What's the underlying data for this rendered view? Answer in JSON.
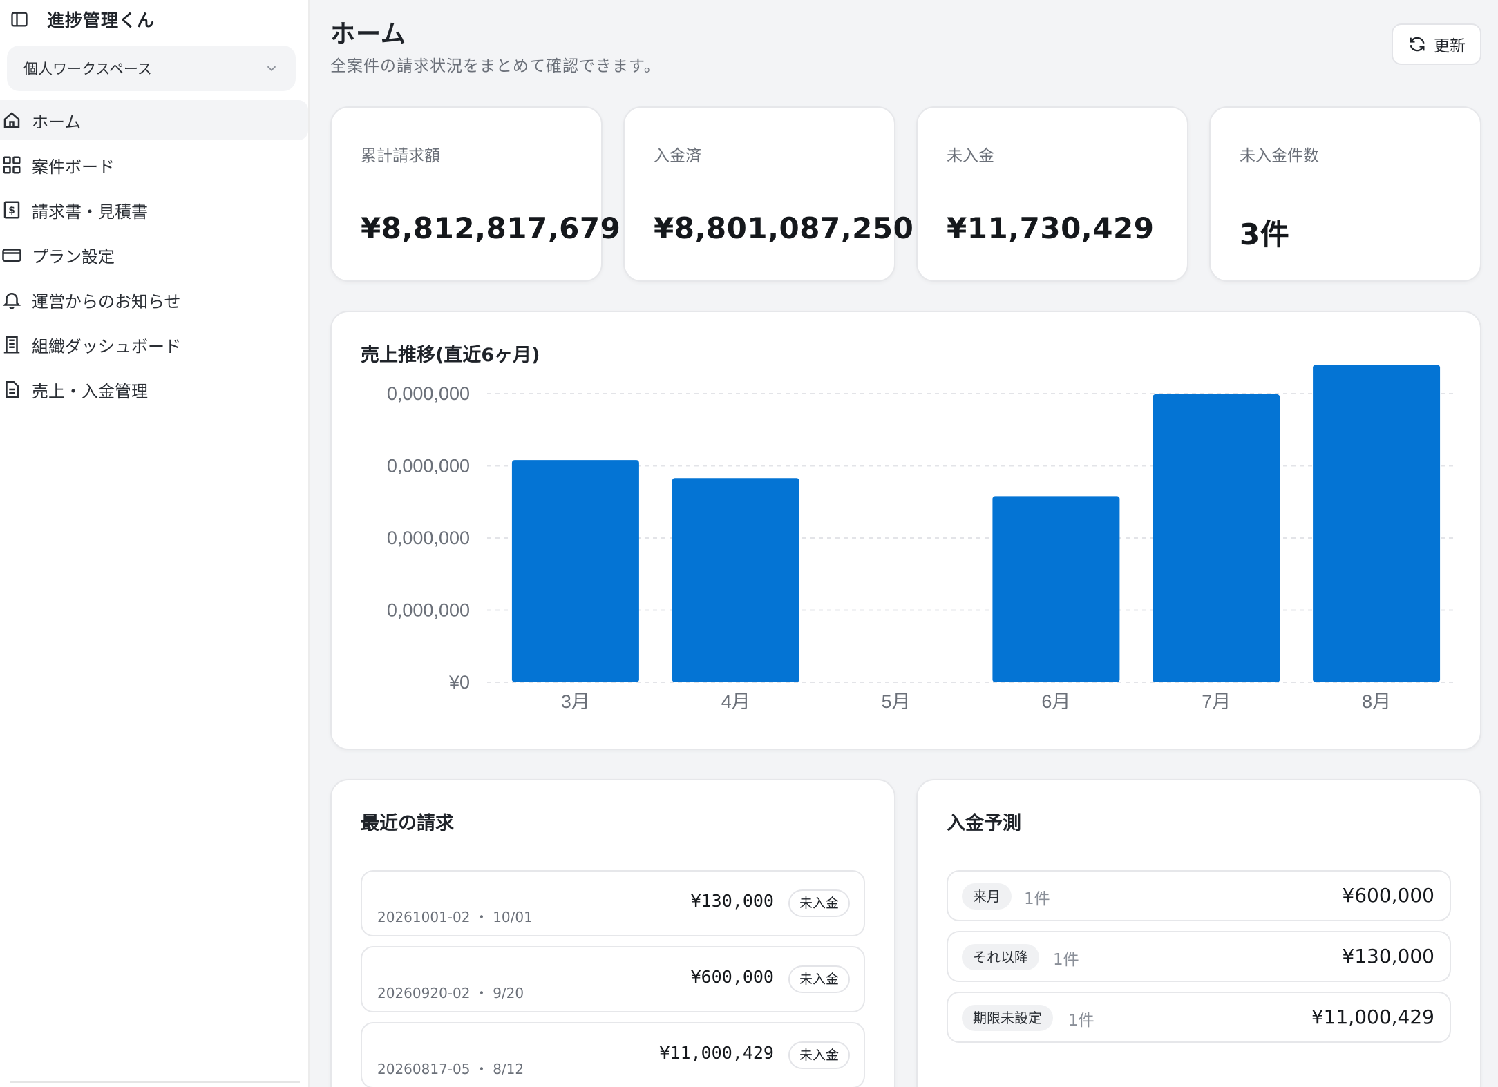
{
  "app": {
    "title": "進捗管理くん"
  },
  "workspace": {
    "selected": "個人ワークスペース"
  },
  "sidebar": {
    "items": [
      {
        "label": "ホーム",
        "icon": "home-icon",
        "active": true
      },
      {
        "label": "案件ボード",
        "icon": "grid-icon",
        "active": false
      },
      {
        "label": "請求書・見積書",
        "icon": "invoice-icon",
        "active": false
      },
      {
        "label": "プラン設定",
        "icon": "credit-card-icon",
        "active": false
      },
      {
        "label": "運営からのお知らせ",
        "icon": "bell-icon",
        "active": false
      },
      {
        "label": "組織ダッシュボード",
        "icon": "building-icon",
        "active": false
      },
      {
        "label": "売上・入金管理",
        "icon": "document-icon",
        "active": false
      }
    ]
  },
  "header": {
    "title": "ホーム",
    "subtitle": "全案件の請求状況をまとめて確認できます。",
    "refresh_label": "更新"
  },
  "stats": [
    {
      "label": "累計請求額",
      "value": "¥8,812,817,679"
    },
    {
      "label": "入金済",
      "value": "¥8,801,087,250"
    },
    {
      "label": "未入金",
      "value": "¥11,730,429"
    },
    {
      "label": "未入金件数",
      "value": "3件"
    }
  ],
  "chart_section": {
    "title": "売上推移(直近6ヶ月)"
  },
  "chart_data": {
    "type": "bar",
    "title": "売上推移(直近6ヶ月)",
    "categories": [
      "3月",
      "4月",
      "5月",
      "6月",
      "7月",
      "8月"
    ],
    "values": [
      3080000000,
      2830000000,
      0,
      2580000000,
      3990000000,
      4500000000
    ],
    "ytick_labels": [
      "¥0",
      "0,000,000",
      "0,000,000",
      "0,000,000",
      "0,000,000"
    ],
    "ylim": [
      0,
      4000000000
    ],
    "grid": true,
    "color": "#0474d4"
  },
  "recent": {
    "title": "最近の請求",
    "rows": [
      {
        "id": "20261001-02",
        "date": "10/01",
        "amount": "¥130,000",
        "status": "未入金"
      },
      {
        "id": "20260920-02",
        "date": "9/20",
        "amount": "¥600,000",
        "status": "未入金"
      },
      {
        "id": "20260817-05",
        "date": "8/12",
        "amount": "¥11,000,429",
        "status": "未入金"
      }
    ]
  },
  "forecast": {
    "title": "入金予測",
    "rows": [
      {
        "label": "来月",
        "count": "1件",
        "amount": "¥600,000"
      },
      {
        "label": "それ以降",
        "count": "1件",
        "amount": "¥130,000"
      },
      {
        "label": "期限未設定",
        "count": "1件",
        "amount": "¥11,000,429"
      }
    ]
  },
  "colors": {
    "accent": "#0474d4",
    "background": "#f3f4f6",
    "card": "#ffffff"
  }
}
